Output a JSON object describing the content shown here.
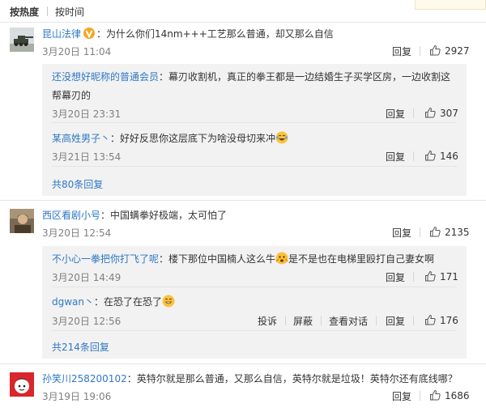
{
  "tabs": {
    "hot": "按热度",
    "time": "按时间"
  },
  "actions": {
    "reply": "回复",
    "report": "投诉",
    "block": "屏蔽",
    "view_conversation": "查看对话"
  },
  "colors": {
    "link": "#2f78c4",
    "meta": "#808080",
    "reply_bg": "#f2f2f2"
  },
  "comments": [
    {
      "user": "昆山法律",
      "badge": "v-gold-icon",
      "text": "：为什么你们14nm+++工艺那么普通，却又那么自信",
      "time": "3月20日 11:04",
      "likes": "2927",
      "replies": [
        {
          "user": "还没想好昵称的普通会员",
          "text_line1": "：幕刃收割机，真正的拳王都是一边结婚生子买学区房，一边收割这",
          "text_line2": "帮幕刃的",
          "time": "3月20日 23:31",
          "likes": "307"
        },
        {
          "user": "某高姓男子丶",
          "text": "：好好反思你这层底下为啥没母切来冲",
          "emoji": "laughing-tears-emoji",
          "time": "3月21日 13:54",
          "likes": "146"
        }
      ],
      "more": "共80条回复"
    },
    {
      "user": "西区看剧小号",
      "text": "：中国螨拳好极端，太可怕了",
      "time": "3月20日 12:54",
      "likes": "2135",
      "replies": [
        {
          "user": "不小心一拳把你打飞了呢",
          "text_a": "：楼下那位中国楠人这么牛",
          "emoji": "scared-face-emoji",
          "text_b": "是不是也在电梯里殴打自己妻女啊",
          "time": "3月20日 14:49",
          "likes": "171"
        },
        {
          "user": "dgwan丶",
          "text": "：在恐了在恐了",
          "emoji": "grin-emoji",
          "time": "3月20日 12:56",
          "likes": "176"
        }
      ],
      "more": "共214条回复"
    },
    {
      "user": "孙笑川258200102",
      "text": "：英特尔就是那么普通，又那么自信，英特尔就是垃圾！英特尔还有底线哪？",
      "time": "3月19日 19:06",
      "likes": "1686"
    }
  ]
}
